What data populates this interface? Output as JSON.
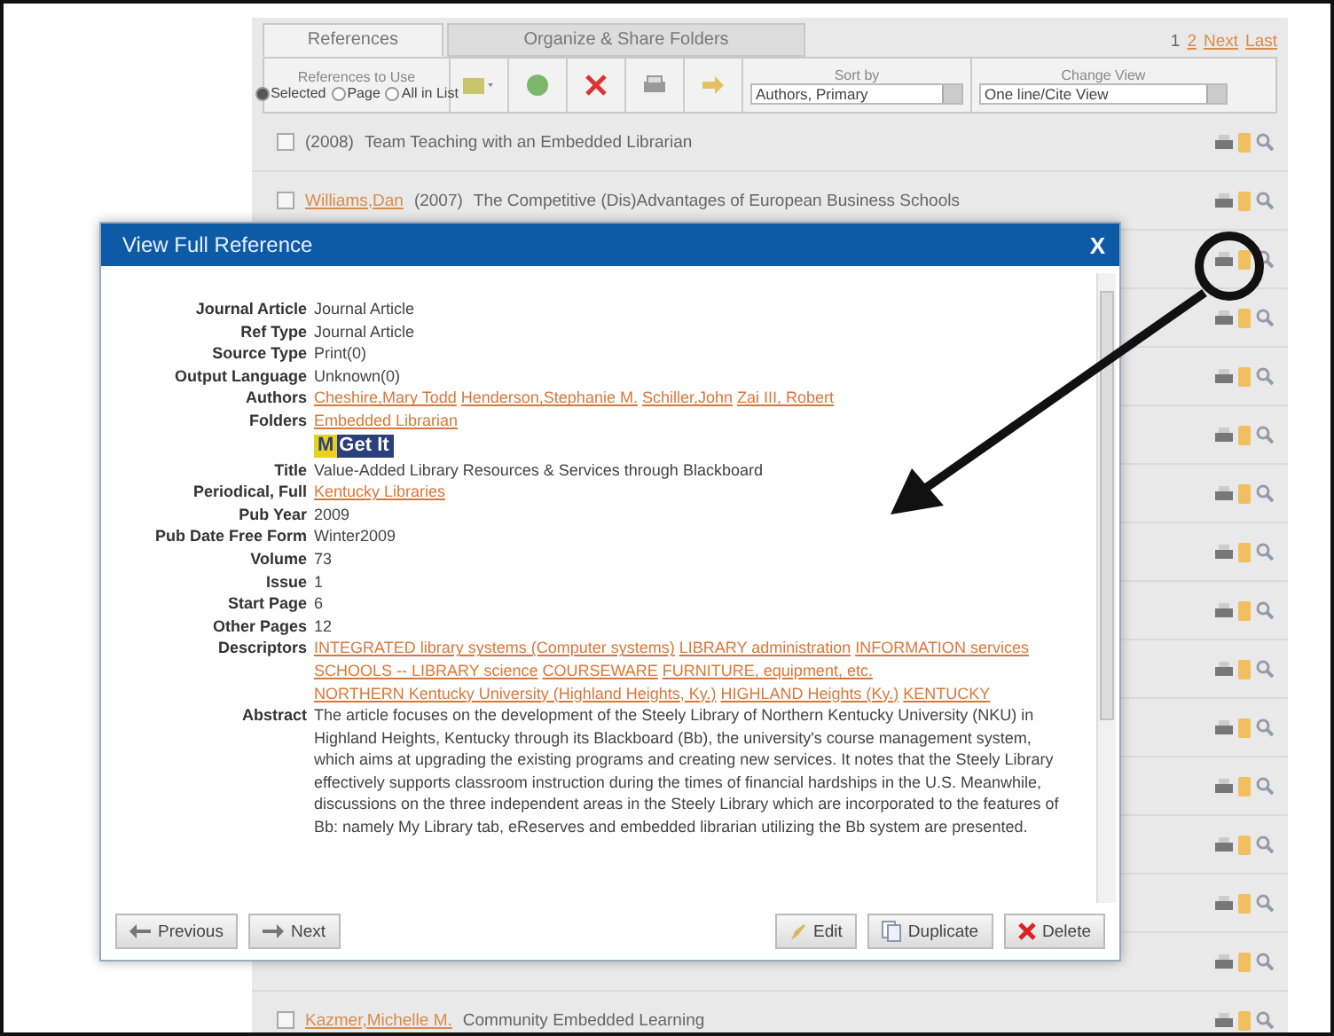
{
  "tabs": [
    {
      "label": "References",
      "selected": true
    },
    {
      "label": "Organize & Share Folders",
      "selected": false
    }
  ],
  "references_to_use": {
    "label": "References to Use",
    "options": [
      {
        "label": "Selected",
        "selected": true
      },
      {
        "label": "Page",
        "selected": false
      },
      {
        "label": "All in List",
        "selected": false
      }
    ]
  },
  "sort_by": {
    "label": "Sort by",
    "value": "Authors, Primary"
  },
  "change_view": {
    "label": "Change View",
    "value": "One line/Cite View"
  },
  "pagination": [
    {
      "label": "1",
      "kind": "plain"
    },
    {
      "label": "2",
      "kind": "link"
    },
    {
      "label": "Next",
      "kind": "link"
    },
    {
      "label": "Last",
      "kind": "link"
    }
  ],
  "rows": [
    {
      "kind": "entry",
      "checked": false,
      "year": "(2008)",
      "title": "Team Teaching with an Embedded Librarian"
    },
    {
      "kind": "entry",
      "checked": false,
      "author": "Williams,Dan",
      "year": "(2007)",
      "title": "The Competitive (Dis)Advantages of European Business Schools"
    },
    {
      "kind": "covered"
    },
    {
      "kind": "covered"
    },
    {
      "kind": "covered"
    },
    {
      "kind": "covered"
    },
    {
      "kind": "covered"
    },
    {
      "kind": "covered"
    },
    {
      "kind": "covered"
    },
    {
      "kind": "covered"
    },
    {
      "kind": "covered"
    },
    {
      "kind": "covered"
    },
    {
      "kind": "covered"
    },
    {
      "kind": "covered"
    },
    {
      "kind": "covered"
    },
    {
      "kind": "entry",
      "checked": false,
      "author": "Kazmer,Michelle M.",
      "title": "Community Embedded Learning"
    }
  ],
  "dialog": {
    "title": "View Full Reference",
    "close": "X",
    "fields": [
      {
        "label": "Journal Article",
        "kind": "text",
        "value": "Journal Article"
      },
      {
        "label": "Ref Type",
        "kind": "text",
        "value": "Journal Article"
      },
      {
        "label": "Source Type",
        "kind": "text",
        "value": "Print(0)"
      },
      {
        "label": "Output Language",
        "kind": "text",
        "value": "Unknown(0)"
      },
      {
        "label": "Authors",
        "kind": "links",
        "links": [
          "Cheshire,Mary Todd",
          "Henderson,Stephanie M.",
          "Schiller,John",
          "Zai III, Robert"
        ]
      },
      {
        "label": "Folders",
        "kind": "links",
        "links": [
          "Embedded Librarian"
        ]
      },
      {
        "kind": "getit",
        "mark": "M",
        "text": "Get It"
      },
      {
        "label": "Title",
        "kind": "text",
        "value": "Value-Added Library Resources & Services through Blackboard"
      },
      {
        "label": "Periodical, Full",
        "kind": "links",
        "links": [
          "Kentucky Libraries"
        ]
      },
      {
        "label": "Pub Year",
        "kind": "text",
        "value": "2009"
      },
      {
        "label": "Pub Date Free Form",
        "kind": "text",
        "value": "Winter2009"
      },
      {
        "label": "Volume",
        "kind": "text",
        "value": "73"
      },
      {
        "label": "Issue",
        "kind": "text",
        "value": "1"
      },
      {
        "label": "Start Page",
        "kind": "text",
        "value": "6"
      },
      {
        "label": "Other Pages",
        "kind": "text",
        "value": "12"
      },
      {
        "label": "Descriptors",
        "kind": "links",
        "links": [
          "INTEGRATED library systems (Computer systems)",
          "LIBRARY administration",
          "INFORMATION services",
          "SCHOOLS -- LIBRARY science",
          "COURSEWARE",
          "FURNITURE, equipment, etc.",
          "NORTHERN Kentucky University (Highland Heights, Ky.)",
          "HIGHLAND Heights (Ky.)",
          "KENTUCKY"
        ]
      },
      {
        "label": "Abstract",
        "kind": "text",
        "value": "The article focuses on the development of the Steely Library of Northern Kentucky University (NKU) in Highland Heights, Kentucky through its Blackboard (Bb), the university's course management system, which aims at upgrading the existing programs and creating new services. It notes that the Steely Library effectively supports classroom instruction during the times of financial hardships in the U.S. Meanwhile, discussions on the three independent areas in the Steely Library which are incorporated to the features of Bb: namely My Library tab, eReserves and embedded librarian utilizing the Bb system are presented."
      }
    ],
    "left_buttons": [
      {
        "label": "Previous",
        "kind": "prev"
      },
      {
        "label": "Next",
        "kind": "next"
      }
    ],
    "right_buttons": [
      {
        "label": "Edit",
        "kind": "edit"
      },
      {
        "label": "Duplicate",
        "kind": "duplicate"
      },
      {
        "label": "Delete",
        "kind": "delete"
      }
    ]
  }
}
